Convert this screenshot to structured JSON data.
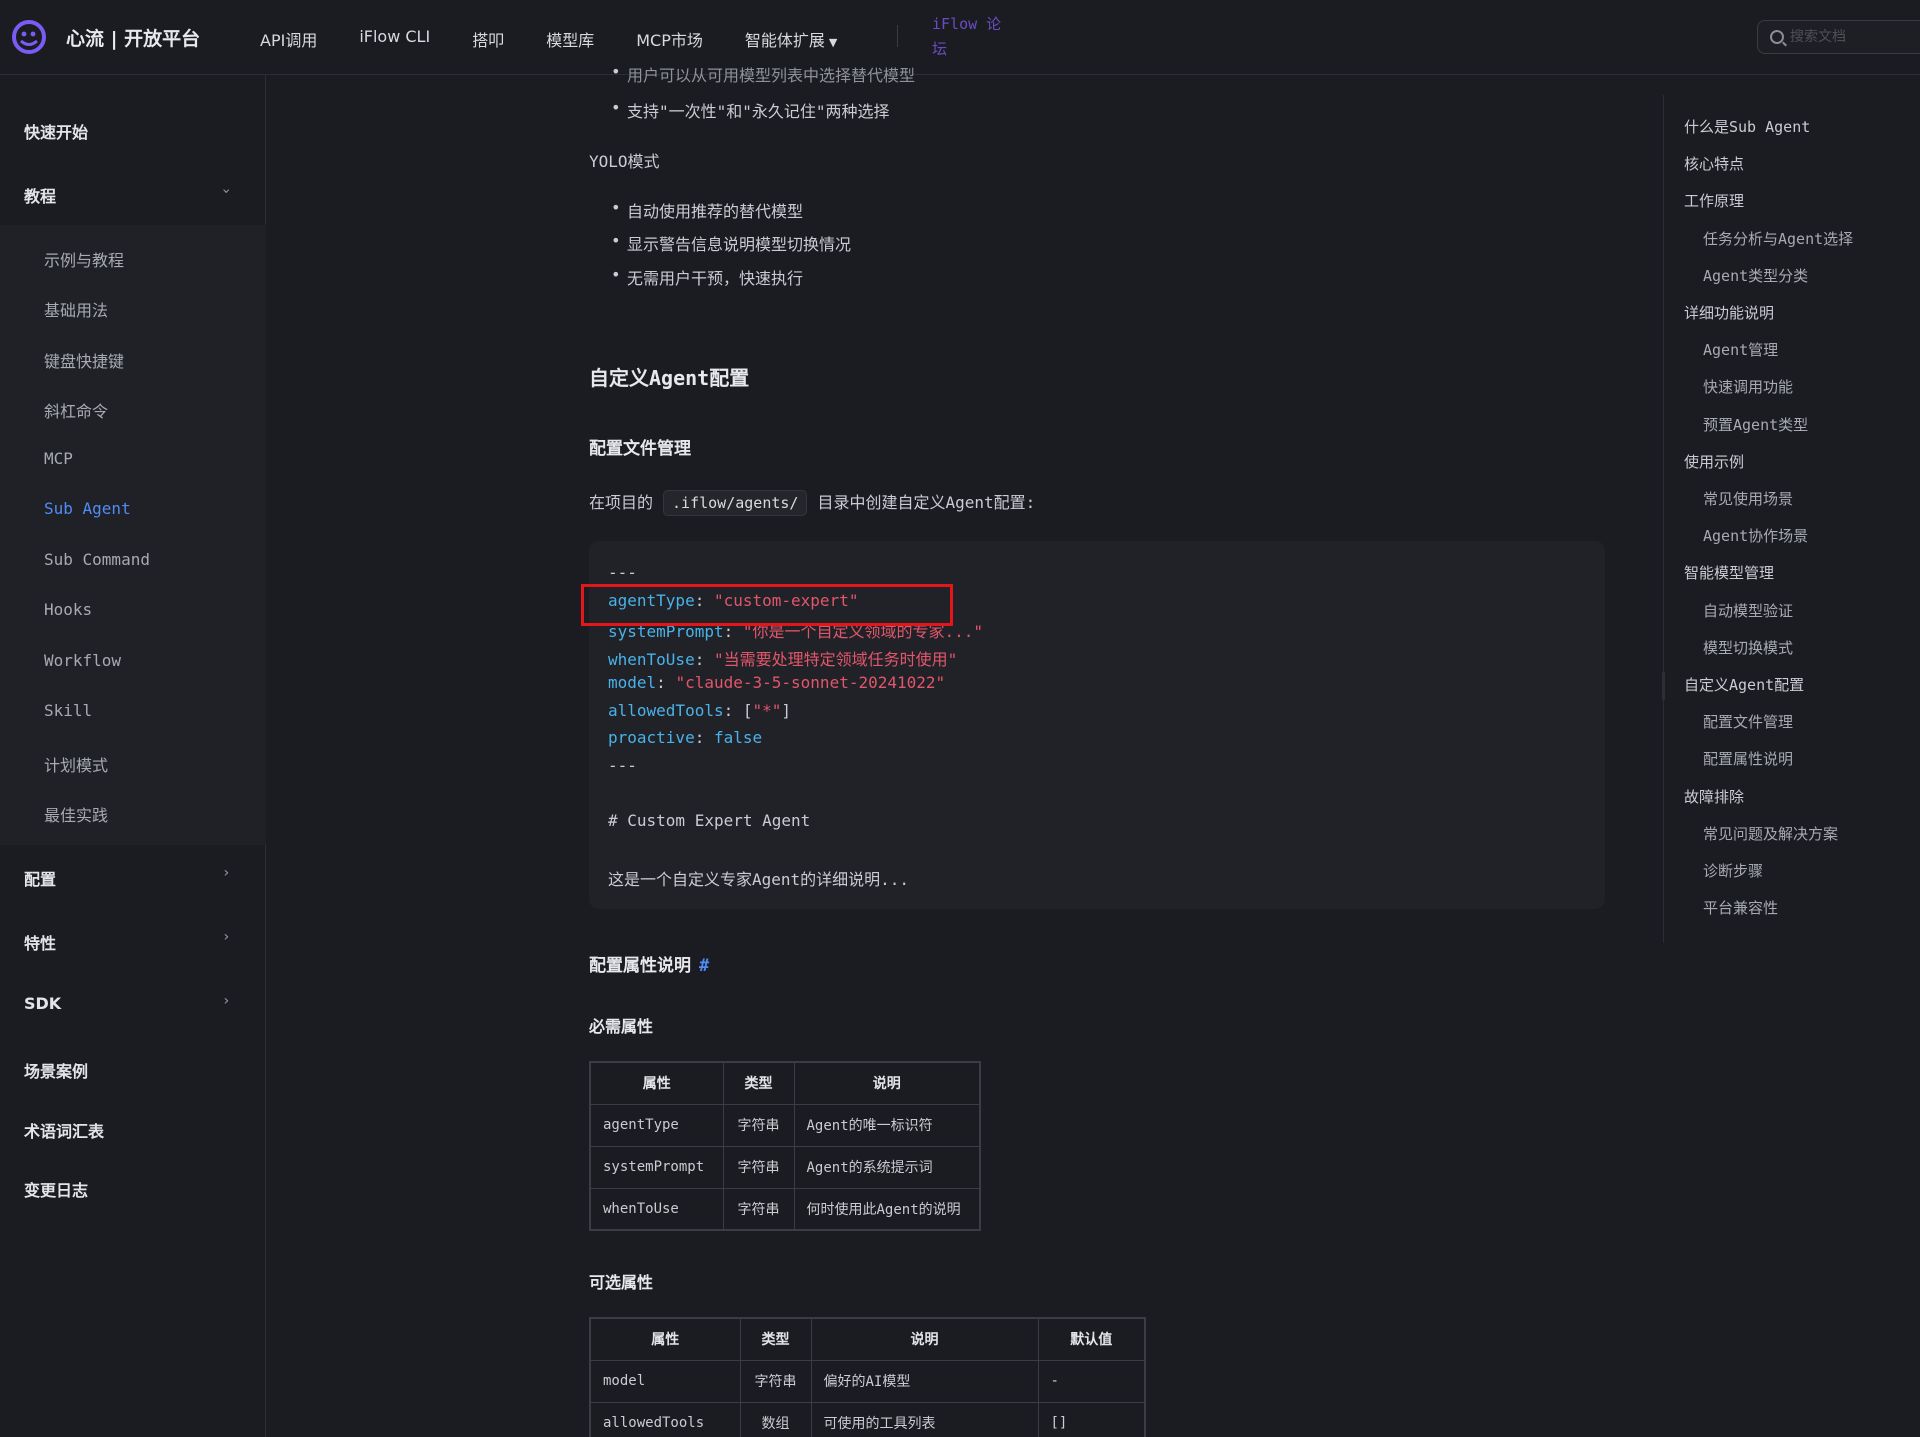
{
  "brand": {
    "name": "心流 | 开放平台"
  },
  "nav": {
    "items": [
      "API调用",
      "iFlow CLI",
      "搭叩",
      "模型库",
      "MCP市场",
      "智能体扩展"
    ],
    "forum": "iFlow 论坛"
  },
  "search": {
    "placeholder": "搜索文档"
  },
  "sidebar": {
    "quick_start": "快速开始",
    "tutorial": "教程",
    "tutorial_items": [
      "示例与教程",
      "基础用法",
      "键盘快捷键",
      "斜杠命令",
      "MCP",
      "Sub Agent",
      "Sub Command",
      "Hooks",
      "Workflow",
      "Skill",
      "计划模式",
      "最佳实践"
    ],
    "config": "配置",
    "features": "特性",
    "sdk": "SDK",
    "cases": "场景案例",
    "glossary": "术语词汇表",
    "changelog": "变更日志"
  },
  "content": {
    "top_cut": "用户可以从可用模型列表中选择替代模型",
    "bullet_top": "支持\"一次性\"和\"永久记住\"两种选择",
    "yolo_title": "YOLO模式",
    "yolo_bullets": [
      "自动使用推荐的替代模型",
      "显示警告信息说明模型切换情况",
      "无需用户干预，快速执行"
    ],
    "h2": "自定义Agent配置",
    "h3_file": "配置文件管理",
    "intro_pre": "在项目的",
    "intro_code": ".iflow/agents/",
    "intro_post": "目录中创建自定义Agent配置:",
    "code": {
      "sep": "---",
      "agentType_key": "agentType",
      "agentType_val": "\"custom-expert\"",
      "systemPrompt_key": "systemPrompt",
      "systemPrompt_val": "\"你是一个自定义领域的专家...\"",
      "whenToUse_key": "whenToUse",
      "whenToUse_val": "\"当需要处理特定领域任务时使用\"",
      "model_key": "model",
      "model_val": "\"claude-3-5-sonnet-20241022\"",
      "allowedTools_key": "allowedTools",
      "allowedTools_open": "[",
      "allowedTools_val": "\"*\"",
      "allowedTools_close": "]",
      "proactive_key": "proactive",
      "proactive_val": "false",
      "heading": "# Custom Expert Agent",
      "desc": "这是一个自定义专家Agent的详细说明..."
    },
    "h3_props": "配置属性说明",
    "anchor": "#",
    "required_title": "必需属性",
    "required_table": {
      "headers": [
        "属性",
        "类型",
        "说明"
      ],
      "rows": [
        [
          "agentType",
          "字符串",
          "Agent的唯一标识符"
        ],
        [
          "systemPrompt",
          "字符串",
          "Agent的系统提示词"
        ],
        [
          "whenToUse",
          "字符串",
          "何时使用此Agent的说明"
        ]
      ]
    },
    "optional_title": "可选属性",
    "optional_table": {
      "headers": [
        "属性",
        "类型",
        "说明",
        "默认值"
      ],
      "rows": [
        [
          "model",
          "字符串",
          "偏好的AI模型",
          "-"
        ],
        [
          "allowedTools",
          "数组",
          "可使用的工具列表",
          "[]"
        ]
      ]
    }
  },
  "toc": {
    "items": [
      {
        "label": "什么是Sub Agent",
        "level": 1
      },
      {
        "label": "核心特点",
        "level": 1
      },
      {
        "label": "工作原理",
        "level": 1
      },
      {
        "label": "任务分析与Agent选择",
        "level": 2
      },
      {
        "label": "Agent类型分类",
        "level": 2
      },
      {
        "label": "详细功能说明",
        "level": 1
      },
      {
        "label": "Agent管理",
        "level": 2
      },
      {
        "label": "快速调用功能",
        "level": 2
      },
      {
        "label": "预置Agent类型",
        "level": 2
      },
      {
        "label": "使用示例",
        "level": 1
      },
      {
        "label": "常见使用场景",
        "level": 2
      },
      {
        "label": "Agent协作场景",
        "level": 2
      },
      {
        "label": "智能模型管理",
        "level": 1
      },
      {
        "label": "自动模型验证",
        "level": 2
      },
      {
        "label": "模型切换模式",
        "level": 2
      },
      {
        "label": "自定义Agent配置",
        "level": 1
      },
      {
        "label": "配置文件管理",
        "level": 2
      },
      {
        "label": "配置属性说明",
        "level": 2
      },
      {
        "label": "故障排除",
        "level": 1
      },
      {
        "label": "常见问题及解决方案",
        "level": 2
      },
      {
        "label": "诊断步骤",
        "level": 2
      },
      {
        "label": "平台兼容性",
        "level": 2
      }
    ]
  },
  "colors": {
    "accent": "#4f8cf7",
    "key": "#49b2e8",
    "string": "#e2566b",
    "highlight": "#e5161a",
    "forum": "#6a4cc2"
  }
}
